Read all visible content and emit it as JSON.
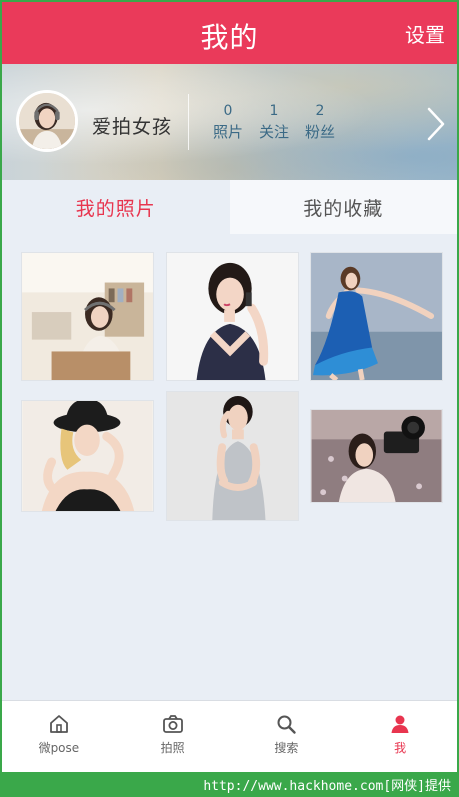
{
  "header": {
    "title": "我的",
    "settings_label": "设置"
  },
  "profile": {
    "username": "爱拍女孩",
    "stats": [
      {
        "count": "0",
        "label": "照片"
      },
      {
        "count": "1",
        "label": "关注"
      },
      {
        "count": "2",
        "label": "粉丝"
      }
    ],
    "chevron_icon": "chevron-right-icon"
  },
  "tabs": [
    {
      "label": "我的照片",
      "active": true
    },
    {
      "label": "我的收藏",
      "active": false
    }
  ],
  "photos": [
    {
      "name": "photo-girl-headphones-room"
    },
    {
      "name": "photo-girl-phone-black-dress"
    },
    {
      "name": "photo-girl-blue-dress-beach"
    },
    {
      "name": "photo-girl-black-hat"
    },
    {
      "name": "photo-girl-silver-dress"
    },
    {
      "name": "photo-girl-camera-field"
    }
  ],
  "bottom_nav": [
    {
      "label": "微pose",
      "icon": "home-icon",
      "active": false
    },
    {
      "label": "拍照",
      "icon": "camera-icon",
      "active": false
    },
    {
      "label": "搜索",
      "icon": "search-icon",
      "active": false
    },
    {
      "label": "我",
      "icon": "user-icon",
      "active": true
    }
  ],
  "watermark": {
    "text": "http://www.hackhome.com[网侠]提供"
  },
  "colors": {
    "accent": "#ea3a5a",
    "background": "#e9eef5",
    "watermark_bar": "#3aa84a"
  }
}
